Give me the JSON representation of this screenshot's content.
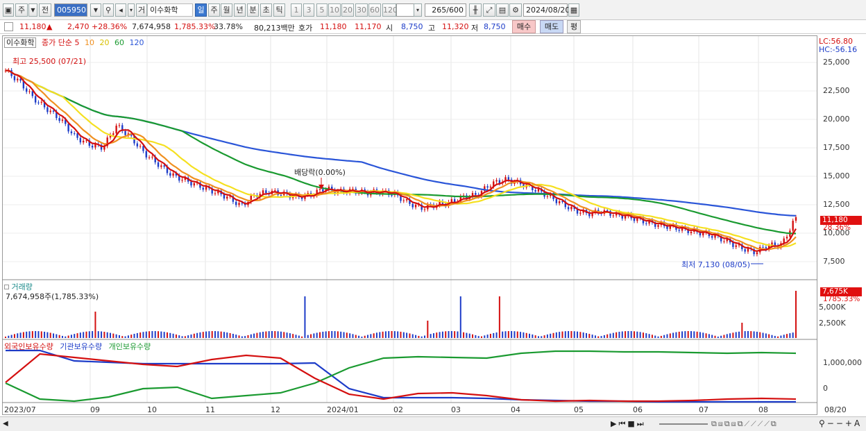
{
  "toolbar": {
    "market": "주",
    "kind": "전",
    "code": "005950",
    "name_prefix": "거",
    "name": "이수화학",
    "periods": [
      "일",
      "주",
      "월",
      "년",
      "분",
      "초",
      "틱"
    ],
    "nums": [
      "1",
      "3",
      "5",
      "10",
      "20",
      "30",
      "60",
      "120"
    ],
    "count": "265",
    "count_max": "/600",
    "date": "2024/08/20"
  },
  "quote": {
    "price": "11,180",
    "arrow": "▲",
    "change": "2,470",
    "pct": "+28.36%",
    "volume": "7,674,958",
    "vol_pct": "1,785.33%",
    "turnover": "33.78%",
    "amount": "80,213백만",
    "hoga_label": "호가",
    "ask": "11,180",
    "bid": "11,170",
    "open_label": "시",
    "open": "8,750",
    "high_label": "고",
    "high": "11,320",
    "low_label": "저",
    "low": "8,750",
    "buy": "매수",
    "sell": "매도",
    "flat": "평"
  },
  "price_panel": {
    "title": "이수화학",
    "legend_label": "종가 단순",
    "ma": [
      "5",
      "10",
      "20",
      "60",
      "120"
    ],
    "lc": "LC:56.80",
    "hc": "HC:-56.16",
    "high_note": "최고 25,500 (07/21)",
    "low_note": "최저 7,130 (08/05)",
    "div_note": "배당락(0.00%)",
    "cur_price": "11,180",
    "cur_pct": "28.36%",
    "yticks": [
      "25,000",
      "22,500",
      "20,000",
      "17,500",
      "15,000",
      "12,500",
      "10,000",
      "7,500"
    ]
  },
  "volume_panel": {
    "title": "거래량",
    "info": "7,674,958주(1,785.33%)",
    "cur": "7,675K",
    "cur_pct": "1785.33%",
    "yticks": [
      "5,000K",
      "2,500K"
    ]
  },
  "holdings_panel": {
    "legend": [
      "외국인보유수량",
      "기관보유수량",
      "개인보유수량"
    ],
    "yticks": [
      "1,000,000",
      "0"
    ]
  },
  "xaxis": [
    "2023/07",
    "09",
    "10",
    "11",
    "12",
    "2024/01",
    "02",
    "03",
    "04",
    "05",
    "06",
    "07",
    "08",
    "08/20"
  ],
  "colors": {
    "up": "#d41010",
    "down": "#1d3cc8",
    "ma5": "#d41010",
    "ma10": "#f09020",
    "ma20": "#f5e020",
    "ma60": "#1a9a30",
    "ma120": "#2a55d8"
  },
  "chart_data": {
    "type": "line",
    "x_range": [
      "2023/07",
      "2024/08/20"
    ],
    "ylim": [
      6000,
      26500
    ],
    "close_approx": [
      24500,
      23500,
      22000,
      21000,
      20000,
      18500,
      17800,
      17500,
      19500,
      18500,
      17000,
      16000,
      15000,
      14500,
      14000,
      13500,
      13000,
      12200,
      13200,
      13500,
      13300,
      13000,
      13200,
      13800,
      13500,
      13600,
      13400,
      13500,
      13300,
      12500,
      12000,
      12300,
      12500,
      13000,
      13200,
      14200,
      14600,
      14300,
      13800,
      13200,
      12500,
      11800,
      11500,
      11700,
      11400,
      11200,
      10800,
      10500,
      10300,
      10000,
      9800,
      9500,
      9000,
      8400,
      8000,
      8600,
      8700,
      11180
    ],
    "volume_panel": {
      "latest": "7,674,958"
    }
  }
}
